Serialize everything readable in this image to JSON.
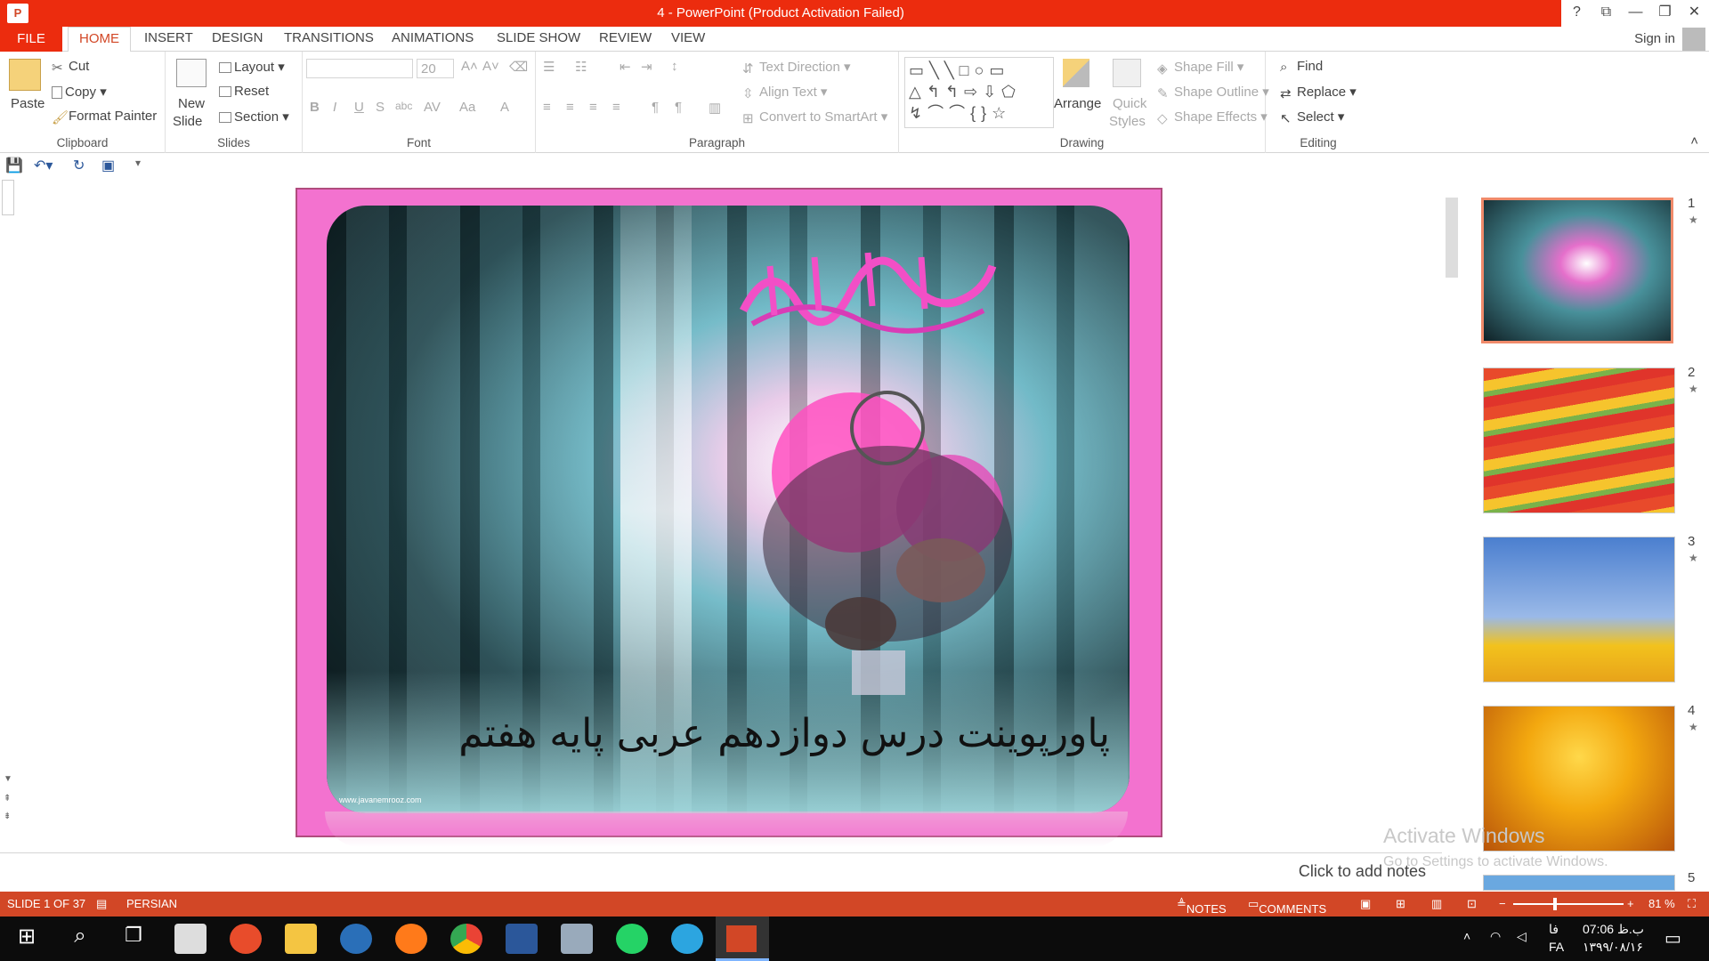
{
  "window": {
    "title": "4 -  PowerPoint (Product Activation Failed)",
    "controls": [
      "?",
      "⧉",
      "—",
      "❐",
      "✕"
    ]
  },
  "tabs": [
    "FILE",
    "HOME",
    "INSERT",
    "DESIGN",
    "TRANSITIONS",
    "ANIMATIONS",
    "SLIDE SHOW",
    "REVIEW",
    "VIEW"
  ],
  "account": {
    "signin": "Sign in"
  },
  "ribbon": {
    "clipboard": {
      "label": "Clipboard",
      "paste": "Paste",
      "cut": "Cut",
      "copy": "Copy",
      "format_painter": "Format Painter"
    },
    "slides": {
      "label": "Slides",
      "new_slide_1": "New",
      "new_slide_2": "Slide",
      "layout": "Layout",
      "reset": "Reset",
      "section": "Section"
    },
    "font": {
      "label": "Font",
      "size": "20"
    },
    "paragraph": {
      "label": "Paragraph",
      "text_direction": "Text Direction",
      "align_text": "Align Text",
      "convert_smartart": "Convert to SmartArt"
    },
    "drawing": {
      "label": "Drawing",
      "arrange": "Arrange",
      "quick_styles_1": "Quick",
      "quick_styles_2": "Styles",
      "shape_fill": "Shape Fill",
      "shape_outline": "Shape Outline",
      "shape_effects": "Shape Effects"
    },
    "editing": {
      "label": "Editing",
      "find": "Find",
      "replace": "Replace",
      "select": "Select"
    }
  },
  "slide": {
    "title": "پاورپوینت درس دوازدهم عربی پایه هفتم",
    "watermark": "www.javanemrooz.com"
  },
  "notes": {
    "placeholder": "Click to add notes"
  },
  "thumbnails": [
    {
      "num": "1",
      "star": "★"
    },
    {
      "num": "2",
      "star": "★"
    },
    {
      "num": "3",
      "star": "★"
    },
    {
      "num": "4",
      "star": "★"
    },
    {
      "num": "5"
    }
  ],
  "activation": {
    "line1": "Activate Windows",
    "line2": "Go to Settings to activate Windows."
  },
  "status": {
    "slide": "SLIDE 1 OF 37",
    "language": "PERSIAN",
    "notes": "NOTES",
    "comments": "COMMENTS",
    "zoom": "81 %"
  },
  "taskbar": {
    "lang": "FA",
    "lang2": "فا",
    "time": "07:06 ب.ظ",
    "date": "۱۳۹۹/۰۸/۱۶"
  },
  "colors": {
    "accent": "#d24726",
    "titlebar": "#ec2c0e",
    "slide_border": "#f372cf"
  }
}
